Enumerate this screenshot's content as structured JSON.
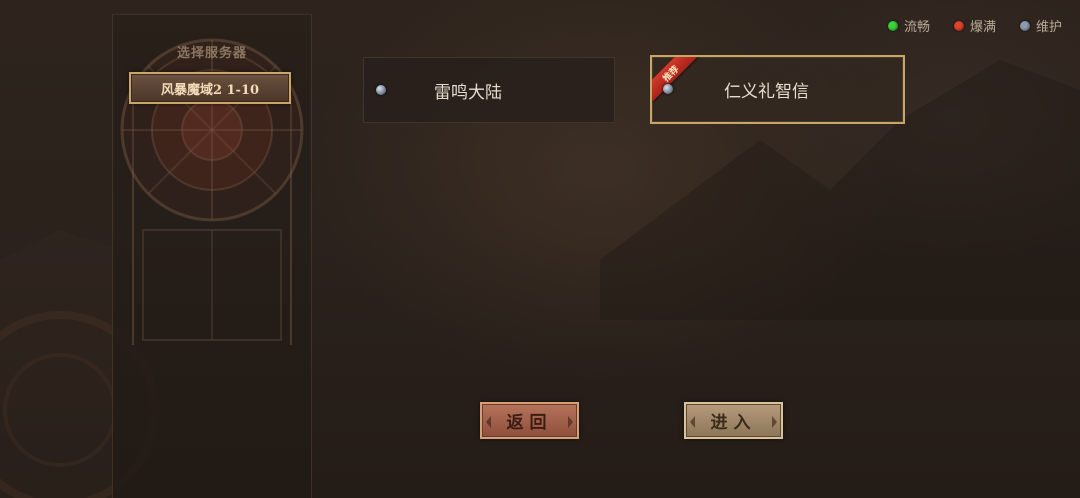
{
  "legend": [
    {
      "label": "流畅",
      "color": "#3bd23b"
    },
    {
      "label": "爆满",
      "color": "#e0432b"
    },
    {
      "label": "维护",
      "color": "#8d9bb0"
    }
  ],
  "left_panel": {
    "title": "选择服务器",
    "category_label": "风暴魔域2 1-10"
  },
  "servers": [
    {
      "name": "雷鸣大陆",
      "status_icon": "status-light-icon",
      "selected": false,
      "badge": ""
    },
    {
      "name": "仁义礼智信",
      "status_icon": "status-light-icon",
      "selected": true,
      "badge": "推荐"
    }
  ],
  "buttons": {
    "back_label": "返回",
    "enter_label": "进入"
  }
}
